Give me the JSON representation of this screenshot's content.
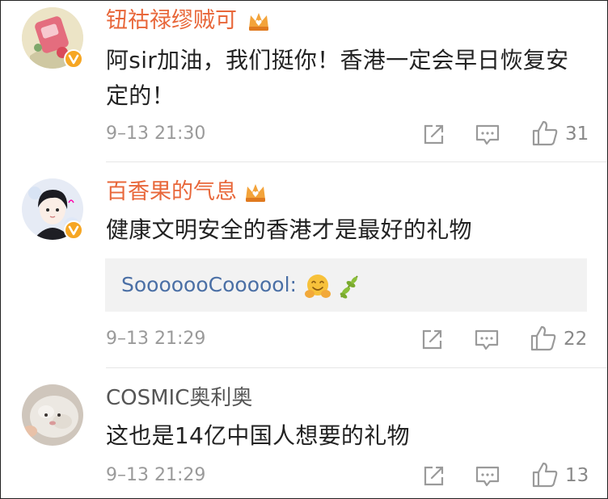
{
  "colors": {
    "vip_name": "#e8673a",
    "plain_name": "#555555",
    "text": "#222222",
    "meta": "#9a9a9a",
    "reply_link": "#4a6fa5",
    "badge": "#f6a623"
  },
  "comments": [
    {
      "username": "钮祜禄缪贼可",
      "vip": true,
      "verified": true,
      "text": "阿sir加油，我们挺你！香港一定会早日恢复安定的！",
      "time": "9–13 21:30",
      "likes": "31",
      "icons": [
        "share-icon",
        "comment-icon",
        "like-icon"
      ]
    },
    {
      "username": "百香果的气息",
      "vip": true,
      "verified": true,
      "text": "健康文明安全的香港才是最好的礼物",
      "reply": {
        "text": "SooooooCoooool:",
        "emojis": [
          "hug-emoji",
          "olive-branch-emoji"
        ]
      },
      "time": "9–13 21:29",
      "likes": "22",
      "icons": [
        "share-icon",
        "comment-icon",
        "like-icon"
      ]
    },
    {
      "username": "COSMIC奥利奥",
      "vip": false,
      "verified": false,
      "text": "这也是14亿中国人想要的礼物",
      "time": "9–13 21:29",
      "likes": "13",
      "icons": [
        "share-icon",
        "comment-icon",
        "like-icon"
      ]
    }
  ]
}
